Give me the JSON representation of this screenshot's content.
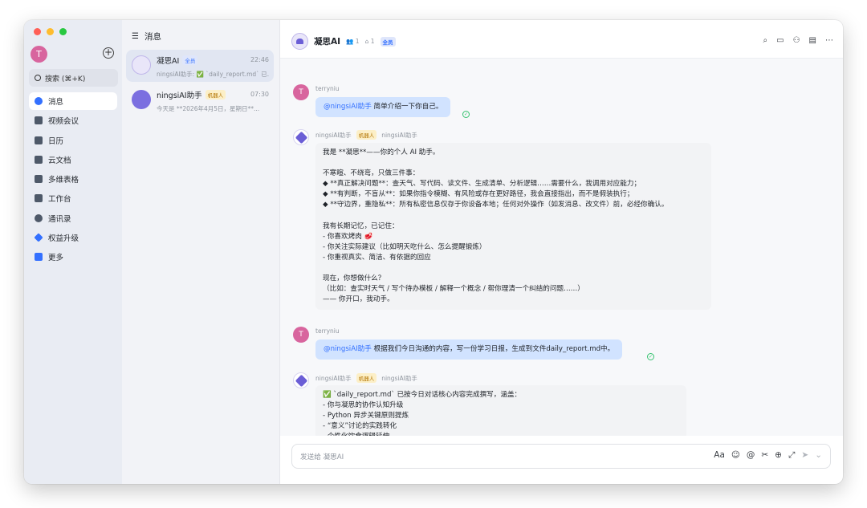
{
  "colors": {
    "accent": "#3370ff",
    "close": "#ff5f57",
    "minimize": "#febc2e",
    "maximize": "#28c840"
  },
  "me": {
    "avatar_letter": "T"
  },
  "search": {
    "label": "搜索 (⌘+K)"
  },
  "nav": [
    {
      "label": "消息",
      "icon": "message-icon",
      "color": "#3370ff"
    },
    {
      "label": "视频会议",
      "icon": "video-icon",
      "color": "#4e5969"
    },
    {
      "label": "日历",
      "icon": "calendar-icon",
      "color": "#4e5969"
    },
    {
      "label": "云文档",
      "icon": "doc-icon",
      "color": "#4e5969"
    },
    {
      "label": "多维表格",
      "icon": "table-icon",
      "color": "#4e5969"
    },
    {
      "label": "工作台",
      "icon": "grid-icon",
      "color": "#4e5969"
    },
    {
      "label": "通讯录",
      "icon": "contacts-icon",
      "color": "#4e5969"
    },
    {
      "label": "权益升级",
      "icon": "diamond-icon",
      "color": "#3370ff"
    },
    {
      "label": "更多",
      "icon": "more-icon",
      "color": "#3370ff"
    }
  ],
  "conv_list": {
    "title": "消息",
    "items": [
      {
        "name": "凝思AI",
        "tag": "全员",
        "time": "22:46",
        "preview": "ningsiAI助手: ✅ `daily_report.md` 已..."
      },
      {
        "name": "ningsiAI助手",
        "tag": "机器人",
        "time": "07:30",
        "preview": "今天是 **2026年4月5日，星期日**..."
      }
    ]
  },
  "chat": {
    "title": "凝思AI",
    "members": "1",
    "owners": "1",
    "tag": "全员",
    "composer_placeholder": "发送给 凝思AI",
    "send": "➤",
    "dropdown": "⌄"
  },
  "messages": [
    {
      "sender": "terryniu",
      "mention": "@ningsiAI助手",
      "text": "简单介绍一下你自己。"
    },
    {
      "sender": "ningsiAI助手",
      "tag": "机器人",
      "sub": "ningsiAI助手",
      "lines": [
        "我是 **凝思**——你的个人 AI 助手。",
        "",
        "不寒暄、不绕弯，只做三件事：",
        "◆ **真正解决问题**：查天气、写代码、读文件、生成清单、分析逻辑……需要什么，我调用对应能力；",
        "◆ **有判断，不盲从**：如果你指令模糊、有风险或存在更好路径，我会直接指出，而不是假装执行；",
        "◆ **守边界，重隐私**：所有私密信息仅存于你设备本地；任何对外操作（如发消息、改文件）前，必经你确认。",
        "",
        "我有长期记忆，已记住：",
        "- 你喜欢烤肉 🥩",
        "- 你关注实际建议（比如明天吃什么、怎么提醒锻炼）",
        "- 你重视真实、简洁、有依据的回应",
        "",
        "现在，你想做什么？",
        "（比如：查实时天气 / 写个待办模板 / 解释一个概念 / 帮你理清一个纠结的问题……）",
        "—— 你开口，我动手。"
      ]
    },
    {
      "sender": "terryniu",
      "mention": "@ningsiAI助手",
      "text": "根据我们今日沟通的内容，写一份学习日报，生成到文件daily_report.md中。"
    },
    {
      "sender": "ningsiAI助手",
      "tag": "机器人",
      "sub": "ningsiAI助手",
      "lines": [
        "✅ `daily_report.md` 已按今日对话核心内容完成撰写，涵盖：",
        "- 你与凝思的协作认知升级",
        "- Python 异步关键原则提炼",
        "- “意义”讨论的实践转化",
        "- 个性化饮食逻辑延伸",
        "- 明日可执行的具体行动项"
      ]
    }
  ]
}
